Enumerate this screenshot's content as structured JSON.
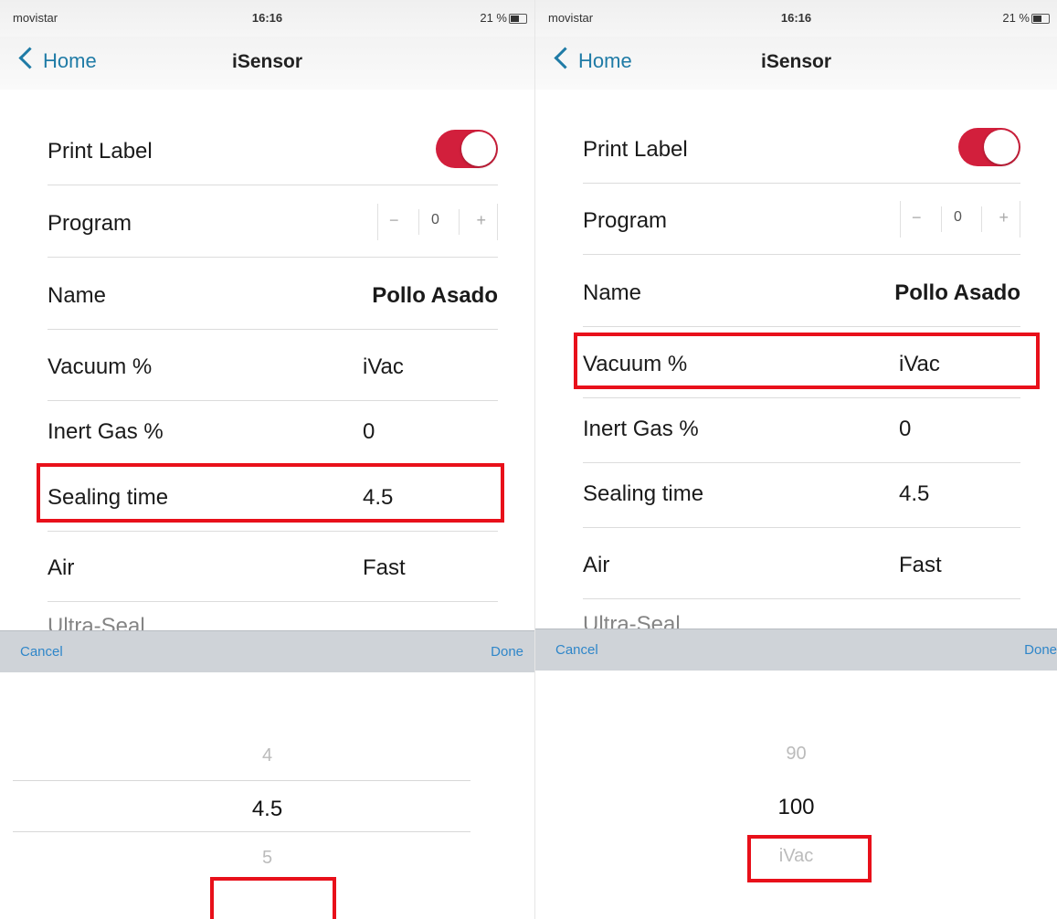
{
  "left": {
    "status": {
      "carrier": "movistar",
      "time": "16:16",
      "battery": "21 %"
    },
    "nav": {
      "back_label": "Home",
      "title": "iSensor"
    },
    "rows": {
      "print_label": {
        "label": "Print Label",
        "toggle_on": true
      },
      "program": {
        "label": "Program",
        "minus": "−",
        "value": "0",
        "plus": "+"
      },
      "name": {
        "label": "Name",
        "value": "Pollo Asado"
      },
      "vacuum": {
        "label": "Vacuum %",
        "value": "iVac"
      },
      "inert_gas": {
        "label": "Inert Gas %",
        "value": "0"
      },
      "sealing_time": {
        "label": "Sealing time",
        "value": "4.5"
      },
      "air": {
        "label": "Air",
        "value": "Fast"
      }
    },
    "peek_label": "Ultra-Seal",
    "toolbar": {
      "cancel": "Cancel",
      "done": "Done"
    },
    "picker": {
      "above": "4",
      "selected": "4.5",
      "below": "5",
      "next": ""
    }
  },
  "right": {
    "status": {
      "carrier": "movistar",
      "time": "16:16",
      "battery": "21 %"
    },
    "nav": {
      "back_label": "Home",
      "title": "iSensor"
    },
    "rows": {
      "print_label": {
        "label": "Print Label",
        "toggle_on": true
      },
      "program": {
        "label": "Program",
        "minus": "−",
        "value": "0",
        "plus": "+"
      },
      "name": {
        "label": "Name",
        "value": "Pollo Asado"
      },
      "vacuum": {
        "label": "Vacuum %",
        "value": "iVac"
      },
      "inert_gas": {
        "label": "Inert Gas %",
        "value": "0"
      },
      "sealing_time": {
        "label": "Sealing time",
        "value": "4.5"
      },
      "air": {
        "label": "Air",
        "value": "Fast"
      }
    },
    "peek_label": "Ultra-Seal",
    "toolbar": {
      "cancel": "Cancel",
      "done": "Done"
    },
    "picker": {
      "above": "90",
      "selected": "100",
      "below": "iVac"
    }
  },
  "colors": {
    "accent": "#d21f3c",
    "link": "#1f7ba6",
    "highlight": "#e8101a"
  }
}
